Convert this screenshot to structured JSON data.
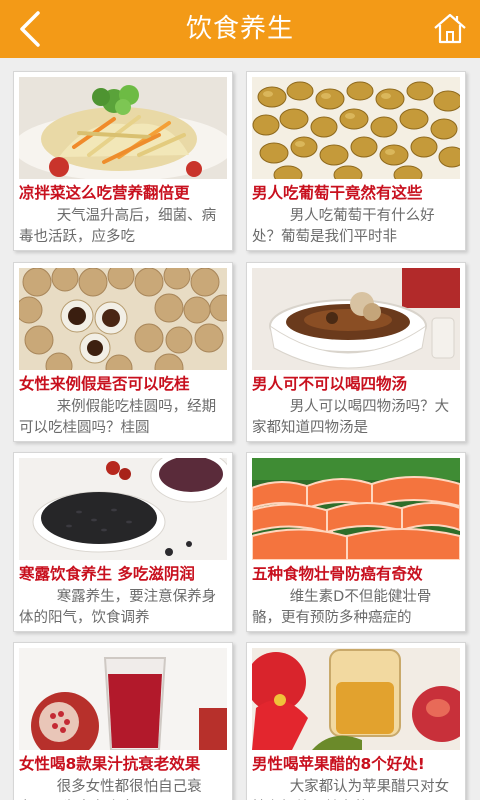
{
  "header": {
    "title": "饮食养生",
    "back_icon": "chevron-left-icon",
    "home_icon": "home-icon",
    "color": "#f39a17"
  },
  "articles": [
    {
      "title": "凉拌菜这么吃营养翻倍更",
      "desc": "天气温升高后，细菌、病毒也活跃，应多吃"
    },
    {
      "title": "男人吃葡萄干竟然有这些",
      "desc": "男人吃葡萄干有什么好处？葡萄是我们平时非"
    },
    {
      "title": "女性来例假是否可以吃桂",
      "desc": "来例假能吃桂圆吗，经期可以吃桂圆吗？桂圆"
    },
    {
      "title": "男人可不可以喝四物汤",
      "desc": "男人可以喝四物汤吗？大家都知道四物汤是"
    },
    {
      "title": "寒露饮食养生 多吃滋阴润",
      "desc": "寒露养生，要注意保养身体的阳气，饮食调养"
    },
    {
      "title": "五种食物壮骨防癌有奇效",
      "desc": "维生素D不但能健壮骨骼，更有预防多种癌症的"
    },
    {
      "title": "女性喝8款果汁抗衰老效果",
      "desc": "很多女性都很怕自己衰老，因为衰老会变丑"
    },
    {
      "title": "男性喝苹果醋的8个好处!",
      "desc": "大家都认为苹果醋只对女性有好处，其实苹果"
    }
  ]
}
